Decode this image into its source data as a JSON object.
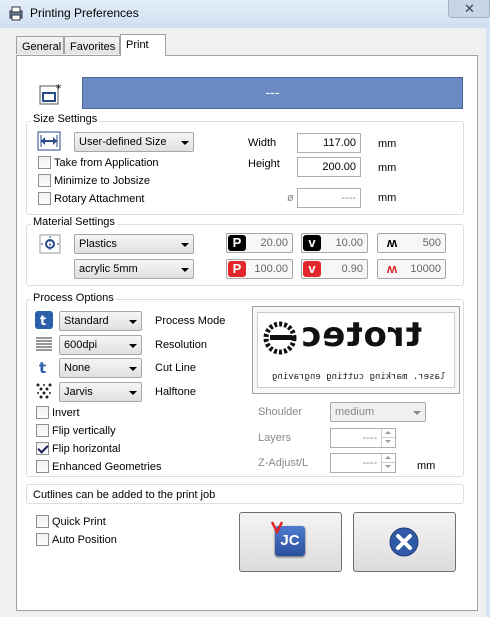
{
  "window": {
    "title": "Printing Preferences",
    "close_glyph": "✕"
  },
  "tabs": [
    {
      "label": "General"
    },
    {
      "label": "Favorites"
    },
    {
      "label": "Print"
    }
  ],
  "job_name": "---",
  "size_settings": {
    "title": "Size Settings",
    "size_mode": "User-defined Size",
    "width_label": "Width",
    "width_value": "117.00",
    "height_label": "Height",
    "height_value": "200.00",
    "unit": "mm",
    "take_from_app": "Take from Application",
    "minimize": "Minimize to Jobsize",
    "rotary": "Rotary Attachment",
    "diameter_symbol": "ø",
    "diameter_value": "----",
    "diameter_unit": "mm"
  },
  "material_settings": {
    "title": "Material Settings",
    "material": "Plastics",
    "submaterial": "acrylic 5mm",
    "params": [
      {
        "icon": "P",
        "value": "20.00",
        "color": "#000000"
      },
      {
        "icon": "v",
        "value": "10.00",
        "color": "#000000"
      },
      {
        "icon": "ʍ",
        "value": "500",
        "color": "#000000"
      },
      {
        "icon": "P",
        "value": "100.00",
        "color": "#e3262b"
      },
      {
        "icon": "v",
        "value": "0.90",
        "color": "#e3262b"
      },
      {
        "icon": "ʍ",
        "value": "10000",
        "color": "#e3262b"
      }
    ]
  },
  "process_options": {
    "title": "Process Options",
    "rows": [
      {
        "value": "Standard",
        "label": "Process Mode"
      },
      {
        "value": "600dpi",
        "label": "Resolution"
      },
      {
        "value": "None",
        "label": "Cut Line"
      },
      {
        "value": "Jarvis",
        "label": "Halftone"
      }
    ],
    "checks": [
      {
        "label": "Invert",
        "checked": false
      },
      {
        "label": "Flip vertically",
        "checked": false
      },
      {
        "label": "Flip horizontal",
        "checked": true
      },
      {
        "label": "Enhanced Geometries",
        "checked": false
      }
    ],
    "preview_logo": "trotec",
    "preview_tagline": "laser. marking cutting engraving",
    "shoulder_label": "Shoulder",
    "shoulder_value": "medium",
    "layers_label": "Layers",
    "layers_value": "----",
    "zadjust_label": "Z-Adjust/L",
    "zadjust_value": "----",
    "zadjust_unit": "mm"
  },
  "info_message": "Cutlines can be added to the print job",
  "bottom": {
    "quick_print": "Quick Print",
    "auto_position": "Auto Position",
    "jc_label": "JC"
  },
  "colors": {
    "job_bar": "#6b8bc2",
    "accent_red": "#e3262b",
    "jc_blue": "#3a64b8",
    "cancel_blue": "#2e5aa8"
  }
}
